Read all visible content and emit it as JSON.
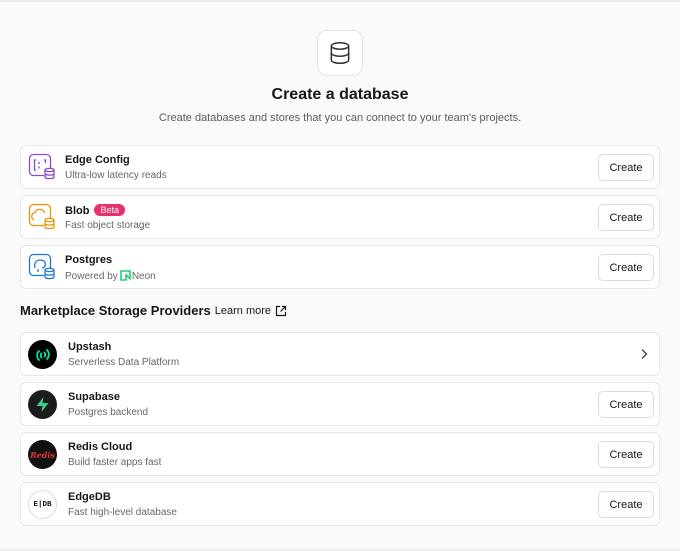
{
  "header": {
    "icon": "database-icon",
    "title": "Create a database",
    "subtitle": "Create databases and stores that you can connect to your team's projects."
  },
  "stores": [
    {
      "name": "Edge Config",
      "desc": "Ultra-low latency reads",
      "icon": "edge-config-icon",
      "color": "#8b4bc4",
      "button": "Create"
    },
    {
      "name": "Blob",
      "badge": "Beta",
      "desc": "Fast object storage",
      "icon": "blob-icon",
      "color": "#e69512",
      "button": "Create"
    },
    {
      "name": "Postgres",
      "desc_prefix": "Powered by",
      "desc_brand": "Neon",
      "desc": "Powered by Neon",
      "icon": "postgres-icon",
      "color": "#1f79d4",
      "button": "Create"
    }
  ],
  "marketplace": {
    "title": "Marketplace Storage Providers",
    "learn_more": "Learn more",
    "providers": [
      {
        "name": "Upstash",
        "desc": "Serverless Data Platform",
        "icon": "upstash-logo-icon",
        "action": "chevron"
      },
      {
        "name": "Supabase",
        "desc": "Postgres backend",
        "icon": "supabase-logo-icon",
        "button": "Create"
      },
      {
        "name": "Redis Cloud",
        "desc": "Build faster apps fast",
        "icon": "redis-logo-icon",
        "logo_text": "Redis",
        "button": "Create"
      },
      {
        "name": "EdgeDB",
        "desc": "Fast high-level database",
        "icon": "edgedb-logo-icon",
        "logo_text": "E|DB",
        "button": "Create"
      }
    ]
  },
  "colors": {
    "badge": "#e8306b",
    "neon": "#21d07a",
    "supabase": "#3ecf8e",
    "redis": "#dc382d"
  }
}
